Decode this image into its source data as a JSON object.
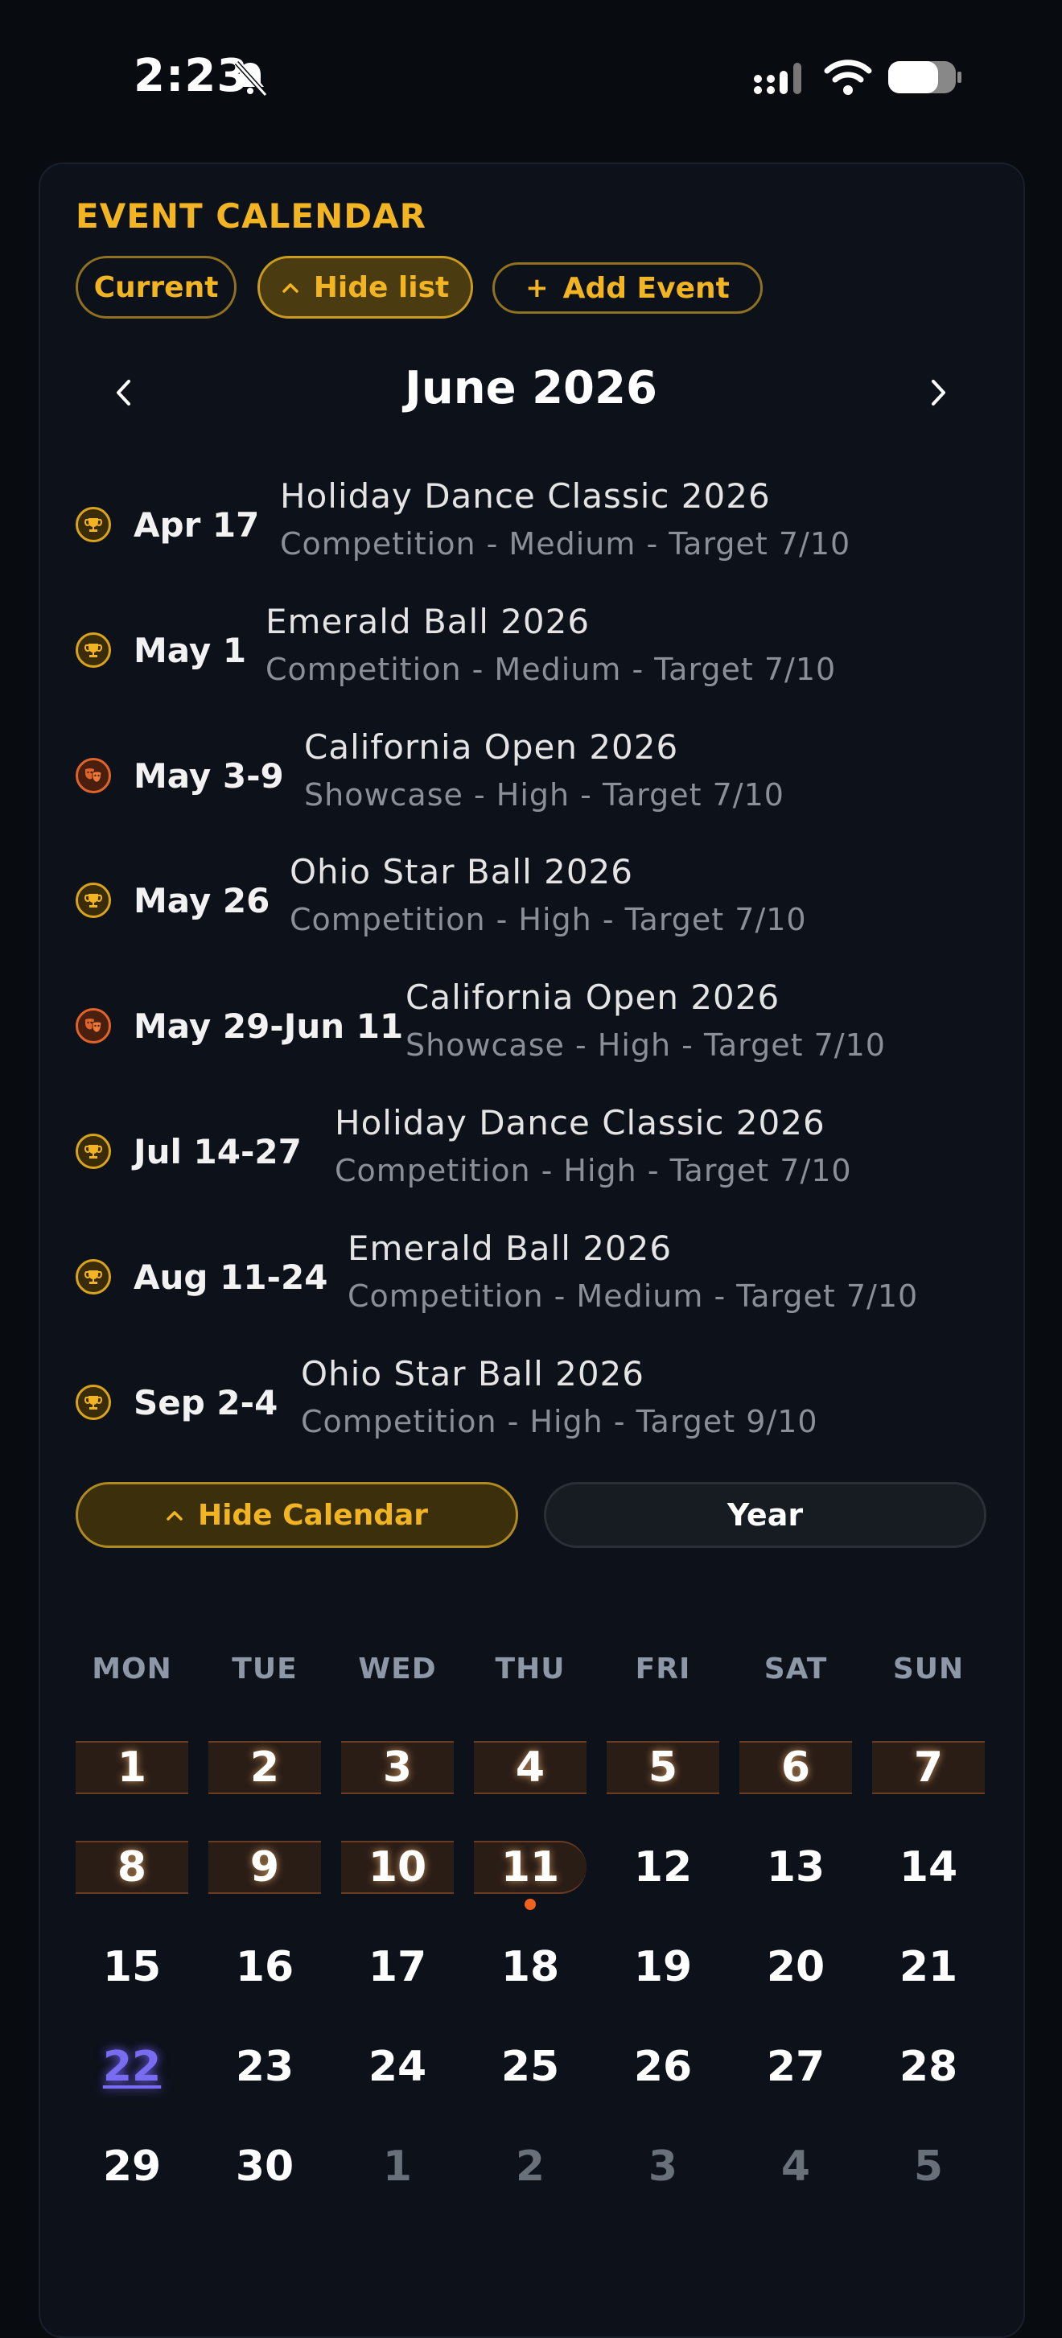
{
  "status_bar": {
    "time": "2:23"
  },
  "header": {
    "title": "EVENT CALENDAR",
    "current_label": "Current",
    "hide_list_label": "Hide list",
    "add_event_label": "Add Event"
  },
  "month_nav": {
    "title": "June 2026"
  },
  "events": [
    {
      "date": "Apr 17",
      "name": "Holiday Dance Classic 2026",
      "meta": "Competition - Medium - Target 7/10",
      "kind": "trophy-icon"
    },
    {
      "date": "May 1",
      "name": "Emerald Ball 2026",
      "meta": "Competition - Medium - Target 7/10",
      "kind": "trophy-icon"
    },
    {
      "date": "May 3-9",
      "name": "California Open 2026",
      "meta": "Showcase - High - Target 7/10",
      "kind": "theater-masks-icon"
    },
    {
      "date": "May 26",
      "name": "Ohio Star Ball 2026",
      "meta": "Competition - High - Target 7/10",
      "kind": "trophy-icon"
    },
    {
      "date": "May 29-Jun 11",
      "name": "California Open 2026",
      "meta": "Showcase - High - Target 7/10",
      "kind": "theater-masks-icon"
    },
    {
      "date": "Jul 14-27",
      "name": "Holiday Dance Classic 2026",
      "meta": "Competition - High - Target 7/10",
      "kind": "trophy-icon"
    },
    {
      "date": "Aug 11-24",
      "name": "Emerald Ball 2026",
      "meta": "Competition - Medium - Target 7/10",
      "kind": "trophy-icon"
    },
    {
      "date": "Sep 2-4",
      "name": "Ohio Star Ball 2026",
      "meta": "Competition - High - Target 9/10",
      "kind": "trophy-icon"
    }
  ],
  "controls": {
    "hide_calendar_label": "Hide Calendar",
    "year_label": "Year"
  },
  "calendar": {
    "weekdays": [
      "MON",
      "TUE",
      "WED",
      "THU",
      "FRI",
      "SAT",
      "SUN"
    ],
    "weeks": [
      [
        "1",
        "2",
        "3",
        "4",
        "5",
        "6",
        "7"
      ],
      [
        "8",
        "9",
        "10",
        "11",
        "12",
        "13",
        "14"
      ],
      [
        "15",
        "16",
        "17",
        "18",
        "19",
        "20",
        "21"
      ],
      [
        "22",
        "23",
        "24",
        "25",
        "26",
        "27",
        "28"
      ],
      [
        "29",
        "30",
        "1",
        "2",
        "3",
        "4",
        "5"
      ]
    ],
    "today": "22",
    "event_range_days": [
      "1",
      "2",
      "3",
      "4",
      "5",
      "6",
      "7",
      "8",
      "9",
      "10",
      "11"
    ]
  },
  "colors": {
    "accent": "#f2b521",
    "showcase": "#e0632a",
    "today": "#7a6cf0",
    "background": "#080b10"
  }
}
